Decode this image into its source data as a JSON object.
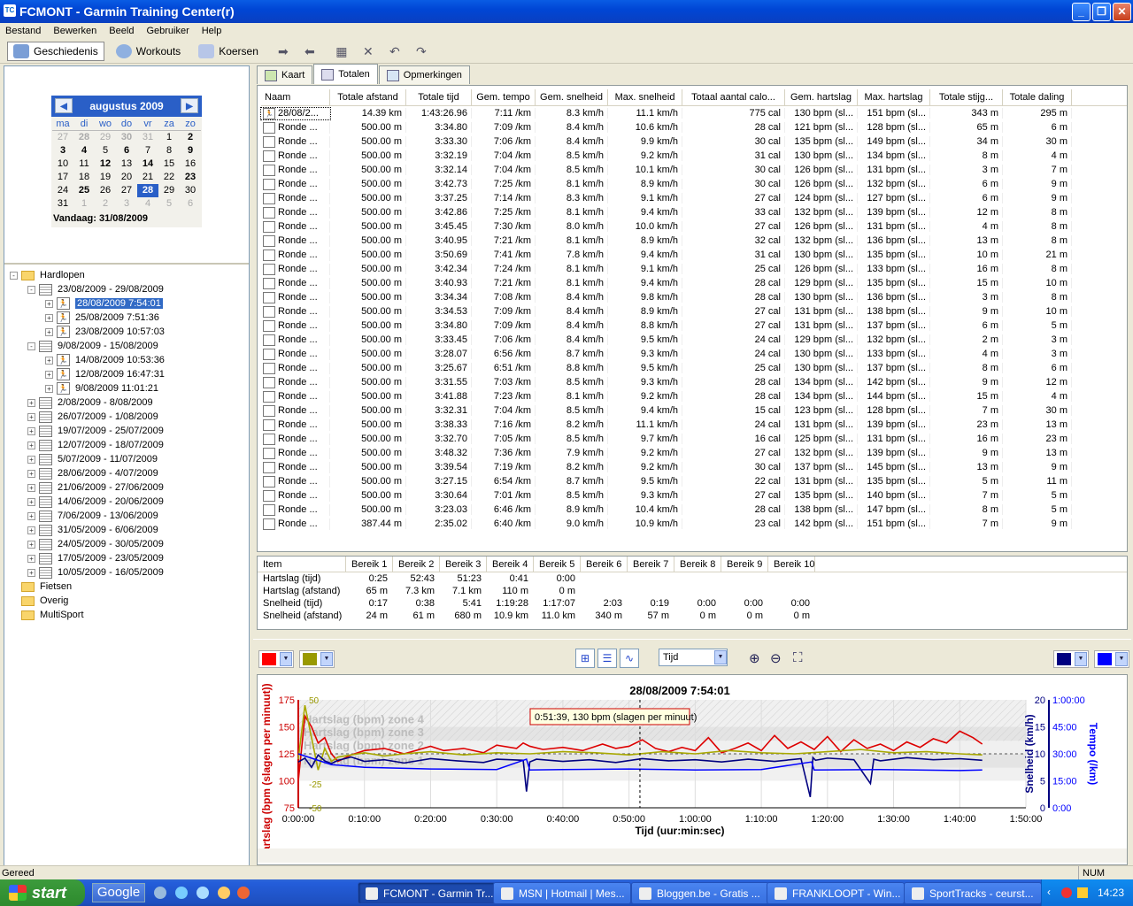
{
  "window": {
    "title": "FCMONT - Garmin Training Center(r)"
  },
  "menu": [
    "Bestand",
    "Bewerken",
    "Beeld",
    "Gebruiker",
    "Help"
  ],
  "toolbar": {
    "history": "Geschiedenis",
    "workouts": "Workouts",
    "courses": "Koersen"
  },
  "calendar": {
    "month": "augustus 2009",
    "days": [
      "ma",
      "di",
      "wo",
      "do",
      "vr",
      "za",
      "zo"
    ],
    "cells": [
      [
        "27",
        "o"
      ],
      [
        "28",
        "ob"
      ],
      [
        "29",
        "o"
      ],
      [
        "30",
        "ob"
      ],
      [
        "31",
        "o"
      ],
      [
        "1",
        ""
      ],
      [
        "2",
        "b"
      ],
      [
        "3",
        "b"
      ],
      [
        "4",
        "b"
      ],
      [
        "5",
        ""
      ],
      [
        "6",
        "b"
      ],
      [
        "7",
        ""
      ],
      [
        "8",
        ""
      ],
      [
        "9",
        "b"
      ],
      [
        "10",
        ""
      ],
      [
        "11",
        ""
      ],
      [
        "12",
        "b"
      ],
      [
        "13",
        ""
      ],
      [
        "14",
        "b"
      ],
      [
        "15",
        ""
      ],
      [
        "16",
        ""
      ],
      [
        "17",
        ""
      ],
      [
        "18",
        ""
      ],
      [
        "19",
        ""
      ],
      [
        "20",
        ""
      ],
      [
        "21",
        ""
      ],
      [
        "22",
        ""
      ],
      [
        "23",
        "b"
      ],
      [
        "24",
        ""
      ],
      [
        "25",
        "b"
      ],
      [
        "26",
        ""
      ],
      [
        "27",
        ""
      ],
      [
        "28",
        "s"
      ],
      [
        "29",
        ""
      ],
      [
        "30",
        ""
      ],
      [
        "31",
        ""
      ],
      [
        "1",
        "o"
      ],
      [
        "2",
        "o"
      ],
      [
        "3",
        "o"
      ],
      [
        "4",
        "o"
      ],
      [
        "5",
        "o"
      ],
      [
        "6",
        "o"
      ]
    ],
    "today": "Vandaag: 31/08/2009"
  },
  "tree": [
    {
      "level": 0,
      "type": "folder",
      "label": "Hardlopen",
      "exp": "-"
    },
    {
      "level": 1,
      "type": "cal",
      "label": "23/08/2009 - 29/08/2009",
      "exp": "-"
    },
    {
      "level": 2,
      "type": "run",
      "label": "28/08/2009 7:54:01",
      "exp": "+",
      "sel": true
    },
    {
      "level": 2,
      "type": "run",
      "label": "25/08/2009 7:51:36",
      "exp": "+"
    },
    {
      "level": 2,
      "type": "run",
      "label": "23/08/2009 10:57:03",
      "exp": "+"
    },
    {
      "level": 1,
      "type": "cal",
      "label": "9/08/2009 - 15/08/2009",
      "exp": "-"
    },
    {
      "level": 2,
      "type": "run",
      "label": "14/08/2009 10:53:36",
      "exp": "+"
    },
    {
      "level": 2,
      "type": "run",
      "label": "12/08/2009 16:47:31",
      "exp": "+"
    },
    {
      "level": 2,
      "type": "run",
      "label": "9/08/2009 11:01:21",
      "exp": "+"
    },
    {
      "level": 1,
      "type": "cal",
      "label": "2/08/2009 - 8/08/2009",
      "exp": "+"
    },
    {
      "level": 1,
      "type": "cal",
      "label": "26/07/2009 - 1/08/2009",
      "exp": "+"
    },
    {
      "level": 1,
      "type": "cal",
      "label": "19/07/2009 - 25/07/2009",
      "exp": "+"
    },
    {
      "level": 1,
      "type": "cal",
      "label": "12/07/2009 - 18/07/2009",
      "exp": "+"
    },
    {
      "level": 1,
      "type": "cal",
      "label": "5/07/2009 - 11/07/2009",
      "exp": "+"
    },
    {
      "level": 1,
      "type": "cal",
      "label": "28/06/2009 - 4/07/2009",
      "exp": "+"
    },
    {
      "level": 1,
      "type": "cal",
      "label": "21/06/2009 - 27/06/2009",
      "exp": "+"
    },
    {
      "level": 1,
      "type": "cal",
      "label": "14/06/2009 - 20/06/2009",
      "exp": "+"
    },
    {
      "level": 1,
      "type": "cal",
      "label": "7/06/2009 - 13/06/2009",
      "exp": "+"
    },
    {
      "level": 1,
      "type": "cal",
      "label": "31/05/2009 - 6/06/2009",
      "exp": "+"
    },
    {
      "level": 1,
      "type": "cal",
      "label": "24/05/2009 - 30/05/2009",
      "exp": "+"
    },
    {
      "level": 1,
      "type": "cal",
      "label": "17/05/2009 - 23/05/2009",
      "exp": "+"
    },
    {
      "level": 1,
      "type": "cal",
      "label": "10/05/2009 - 16/05/2009",
      "exp": "+"
    },
    {
      "level": 0,
      "type": "folder",
      "label": "Fietsen",
      "exp": ""
    },
    {
      "level": 0,
      "type": "folder",
      "label": "Overig",
      "exp": ""
    },
    {
      "level": 0,
      "type": "folder",
      "label": "MultiSport",
      "exp": ""
    }
  ],
  "tabs": [
    "Kaart",
    "Totalen",
    "Opmerkingen"
  ],
  "laps": {
    "columns": [
      "Naam",
      "Totale afstand",
      "Totale tijd",
      "Gem. tempo",
      "Gem. snelheid",
      "Max. snelheid",
      "Totaal aantal calo...",
      "Gem. hartslag",
      "Max. hartslag",
      "Totale stijg...",
      "Totale daling"
    ],
    "rows": [
      [
        "28/08/2...",
        "14.39 km",
        "1:43:26.96",
        "7:11 /km",
        "8.3 km/h",
        "11.1 km/h",
        "775 cal",
        "130 bpm (sl...",
        "151 bpm (sl...",
        "343 m",
        "295 m"
      ],
      [
        "Ronde ...",
        "500.00 m",
        "3:34.80",
        "7:09 /km",
        "8.4 km/h",
        "10.6 km/h",
        "28 cal",
        "121 bpm (sl...",
        "128 bpm (sl...",
        "65 m",
        "6 m"
      ],
      [
        "Ronde ...",
        "500.00 m",
        "3:33.30",
        "7:06 /km",
        "8.4 km/h",
        "9.9 km/h",
        "30 cal",
        "135 bpm (sl...",
        "149 bpm (sl...",
        "34 m",
        "30 m"
      ],
      [
        "Ronde ...",
        "500.00 m",
        "3:32.19",
        "7:04 /km",
        "8.5 km/h",
        "9.2 km/h",
        "31 cal",
        "130 bpm (sl...",
        "134 bpm (sl...",
        "8 m",
        "4 m"
      ],
      [
        "Ronde ...",
        "500.00 m",
        "3:32.14",
        "7:04 /km",
        "8.5 km/h",
        "10.1 km/h",
        "30 cal",
        "126 bpm (sl...",
        "131 bpm (sl...",
        "3 m",
        "7 m"
      ],
      [
        "Ronde ...",
        "500.00 m",
        "3:42.73",
        "7:25 /km",
        "8.1 km/h",
        "8.9 km/h",
        "30 cal",
        "126 bpm (sl...",
        "132 bpm (sl...",
        "6 m",
        "9 m"
      ],
      [
        "Ronde ...",
        "500.00 m",
        "3:37.25",
        "7:14 /km",
        "8.3 km/h",
        "9.1 km/h",
        "27 cal",
        "124 bpm (sl...",
        "127 bpm (sl...",
        "6 m",
        "9 m"
      ],
      [
        "Ronde ...",
        "500.00 m",
        "3:42.86",
        "7:25 /km",
        "8.1 km/h",
        "9.4 km/h",
        "33 cal",
        "132 bpm (sl...",
        "139 bpm (sl...",
        "12 m",
        "8 m"
      ],
      [
        "Ronde ...",
        "500.00 m",
        "3:45.45",
        "7:30 /km",
        "8.0 km/h",
        "10.0 km/h",
        "27 cal",
        "126 bpm (sl...",
        "131 bpm (sl...",
        "4 m",
        "8 m"
      ],
      [
        "Ronde ...",
        "500.00 m",
        "3:40.95",
        "7:21 /km",
        "8.1 km/h",
        "8.9 km/h",
        "32 cal",
        "132 bpm (sl...",
        "136 bpm (sl...",
        "13 m",
        "8 m"
      ],
      [
        "Ronde ...",
        "500.00 m",
        "3:50.69",
        "7:41 /km",
        "7.8 km/h",
        "9.4 km/h",
        "31 cal",
        "130 bpm (sl...",
        "135 bpm (sl...",
        "10 m",
        "21 m"
      ],
      [
        "Ronde ...",
        "500.00 m",
        "3:42.34",
        "7:24 /km",
        "8.1 km/h",
        "9.1 km/h",
        "25 cal",
        "126 bpm (sl...",
        "133 bpm (sl...",
        "16 m",
        "8 m"
      ],
      [
        "Ronde ...",
        "500.00 m",
        "3:40.93",
        "7:21 /km",
        "8.1 km/h",
        "9.4 km/h",
        "28 cal",
        "129 bpm (sl...",
        "135 bpm (sl...",
        "15 m",
        "10 m"
      ],
      [
        "Ronde ...",
        "500.00 m",
        "3:34.34",
        "7:08 /km",
        "8.4 km/h",
        "9.8 km/h",
        "28 cal",
        "130 bpm (sl...",
        "136 bpm (sl...",
        "3 m",
        "8 m"
      ],
      [
        "Ronde ...",
        "500.00 m",
        "3:34.53",
        "7:09 /km",
        "8.4 km/h",
        "8.9 km/h",
        "27 cal",
        "131 bpm (sl...",
        "138 bpm (sl...",
        "9 m",
        "10 m"
      ],
      [
        "Ronde ...",
        "500.00 m",
        "3:34.80",
        "7:09 /km",
        "8.4 km/h",
        "8.8 km/h",
        "27 cal",
        "131 bpm (sl...",
        "137 bpm (sl...",
        "6 m",
        "5 m"
      ],
      [
        "Ronde ...",
        "500.00 m",
        "3:33.45",
        "7:06 /km",
        "8.4 km/h",
        "9.5 km/h",
        "24 cal",
        "129 bpm (sl...",
        "132 bpm (sl...",
        "2 m",
        "3 m"
      ],
      [
        "Ronde ...",
        "500.00 m",
        "3:28.07",
        "6:56 /km",
        "8.7 km/h",
        "9.3 km/h",
        "24 cal",
        "130 bpm (sl...",
        "133 bpm (sl...",
        "4 m",
        "3 m"
      ],
      [
        "Ronde ...",
        "500.00 m",
        "3:25.67",
        "6:51 /km",
        "8.8 km/h",
        "9.5 km/h",
        "25 cal",
        "130 bpm (sl...",
        "137 bpm (sl...",
        "8 m",
        "6 m"
      ],
      [
        "Ronde ...",
        "500.00 m",
        "3:31.55",
        "7:03 /km",
        "8.5 km/h",
        "9.3 km/h",
        "28 cal",
        "134 bpm (sl...",
        "142 bpm (sl...",
        "9 m",
        "12 m"
      ],
      [
        "Ronde ...",
        "500.00 m",
        "3:41.88",
        "7:23 /km",
        "8.1 km/h",
        "9.2 km/h",
        "28 cal",
        "134 bpm (sl...",
        "144 bpm (sl...",
        "15 m",
        "4 m"
      ],
      [
        "Ronde ...",
        "500.00 m",
        "3:32.31",
        "7:04 /km",
        "8.5 km/h",
        "9.4 km/h",
        "15 cal",
        "123 bpm (sl...",
        "128 bpm (sl...",
        "7 m",
        "30 m"
      ],
      [
        "Ronde ...",
        "500.00 m",
        "3:38.33",
        "7:16 /km",
        "8.2 km/h",
        "11.1 km/h",
        "24 cal",
        "131 bpm (sl...",
        "139 bpm (sl...",
        "23 m",
        "13 m"
      ],
      [
        "Ronde ...",
        "500.00 m",
        "3:32.70",
        "7:05 /km",
        "8.5 km/h",
        "9.7 km/h",
        "16 cal",
        "125 bpm (sl...",
        "131 bpm (sl...",
        "16 m",
        "23 m"
      ],
      [
        "Ronde ...",
        "500.00 m",
        "3:48.32",
        "7:36 /km",
        "7.9 km/h",
        "9.2 km/h",
        "27 cal",
        "132 bpm (sl...",
        "139 bpm (sl...",
        "9 m",
        "13 m"
      ],
      [
        "Ronde ...",
        "500.00 m",
        "3:39.54",
        "7:19 /km",
        "8.2 km/h",
        "9.2 km/h",
        "30 cal",
        "137 bpm (sl...",
        "145 bpm (sl...",
        "13 m",
        "9 m"
      ],
      [
        "Ronde ...",
        "500.00 m",
        "3:27.15",
        "6:54 /km",
        "8.7 km/h",
        "9.5 km/h",
        "22 cal",
        "131 bpm (sl...",
        "135 bpm (sl...",
        "5 m",
        "11 m"
      ],
      [
        "Ronde ...",
        "500.00 m",
        "3:30.64",
        "7:01 /km",
        "8.5 km/h",
        "9.3 km/h",
        "27 cal",
        "135 bpm (sl...",
        "140 bpm (sl...",
        "7 m",
        "5 m"
      ],
      [
        "Ronde ...",
        "500.00 m",
        "3:23.03",
        "6:46 /km",
        "8.9 km/h",
        "10.4 km/h",
        "28 cal",
        "138 bpm (sl...",
        "147 bpm (sl...",
        "8 m",
        "5 m"
      ],
      [
        "Ronde ...",
        "387.44 m",
        "2:35.02",
        "6:40 /km",
        "9.0 km/h",
        "10.9 km/h",
        "23 cal",
        "142 bpm (sl...",
        "151 bpm (sl...",
        "7 m",
        "9 m"
      ]
    ]
  },
  "zones": {
    "columns": [
      "Item",
      "Bereik 1",
      "Bereik 2",
      "Bereik 3",
      "Bereik 4",
      "Bereik 5",
      "Bereik 6",
      "Bereik 7",
      "Bereik 8",
      "Bereik 9",
      "Bereik 10"
    ],
    "rows": [
      [
        "Hartslag (tijd)",
        "0:25",
        "52:43",
        "51:23",
        "0:41",
        "0:00",
        "",
        "",
        "",
        "",
        ""
      ],
      [
        "Hartslag (afstand)",
        "65 m",
        "7.3 km",
        "7.1 km",
        "110 m",
        "0 m",
        "",
        "",
        "",
        "",
        ""
      ],
      [
        "Snelheid (tijd)",
        "0:17",
        "0:38",
        "5:41",
        "1:19:28",
        "1:17:07",
        "2:03",
        "0:19",
        "0:00",
        "0:00",
        "0:00"
      ],
      [
        "Snelheid (afstand)",
        "24 m",
        "61 m",
        "680 m",
        "10.9 km",
        "11.0 km",
        "340 m",
        "57 m",
        "0 m",
        "0 m",
        "0 m"
      ]
    ]
  },
  "graph": {
    "axis_select": "Tijd",
    "colors": {
      "hr": "#ff0000",
      "elev": "#999900",
      "speed": "#000080",
      "pace": "#0000ff"
    }
  },
  "chart_data": {
    "type": "line",
    "title": "28/08/2009 7:54:01",
    "xlabel": "Tijd (uur:min:sec)",
    "ylabel_left": "Hartslag (bpm (slagen per minuut))",
    "ylabel_right": [
      "Snelheid (km/h)",
      "Tempo (/km)"
    ],
    "x_ticks": [
      "0:00:00",
      "0:10:00",
      "0:20:00",
      "0:30:00",
      "0:40:00",
      "0:50:00",
      "1:00:00",
      "1:10:00",
      "1:20:00",
      "1:30:00",
      "1:40:00",
      "1:50:00"
    ],
    "xlim_min": [
      0,
      110
    ],
    "y_left_ticks": [
      "75",
      "100",
      "125",
      "150",
      "175"
    ],
    "ylim_left": [
      75,
      175
    ],
    "y_right_speed_ticks": [
      "0",
      "5",
      "10",
      "15",
      "20"
    ],
    "y_right_pace_ticks": [
      "0:00",
      "15:00",
      "30:00",
      "45:00",
      "1:00:00"
    ],
    "zones": [
      "Hartslag (bpm) zone 4",
      "Hartslag (bpm) zone 3",
      "Hartslag (bpm) zone 2",
      "Hartslag (bpm) zone 1"
    ],
    "elev_ticks": [
      "-25",
      "-50",
      "50"
    ],
    "tooltip": "0:51:39, 130 bpm (slagen per minuut)",
    "series": [
      {
        "name": "Hartslag",
        "color": "#dd0000",
        "x": [
          0,
          1,
          2,
          3,
          4,
          5,
          6,
          8,
          10,
          13,
          16,
          20,
          22,
          25,
          28,
          30,
          33,
          34,
          35,
          37,
          40,
          43,
          46,
          48,
          50,
          52,
          54,
          56,
          58,
          60,
          62,
          64,
          66,
          68,
          70,
          72,
          74,
          76,
          78,
          80,
          82,
          84,
          86,
          88,
          90,
          92,
          94,
          96,
          98,
          100,
          102,
          103.4
        ],
        "y": [
          100,
          160,
          150,
          135,
          140,
          125,
          118,
          124,
          128,
          130,
          125,
          132,
          128,
          130,
          126,
          133,
          130,
          135,
          132,
          129,
          131,
          128,
          134,
          130,
          132,
          138,
          130,
          127,
          131,
          128,
          140,
          126,
          130,
          135,
          128,
          142,
          130,
          136,
          129,
          141,
          127,
          138,
          130,
          134,
          128,
          136,
          131,
          139,
          135,
          146,
          140,
          134
        ]
      },
      {
        "name": "Hoogte",
        "color": "#a8a800",
        "x": [
          0,
          1,
          2,
          3,
          4,
          5,
          6,
          8,
          10,
          13,
          16,
          20,
          25,
          30,
          35,
          40,
          45,
          50,
          55,
          60,
          65,
          70,
          75,
          80,
          85,
          90,
          95,
          100,
          103.4
        ],
        "y": [
          120,
          170,
          140,
          110,
          130,
          118,
          122,
          124,
          126,
          123,
          125,
          127,
          124,
          126,
          125,
          127,
          126,
          124,
          127,
          125,
          128,
          126,
          125,
          127,
          129,
          126,
          127,
          125,
          124
        ]
      },
      {
        "name": "Snelheid",
        "color": "#000080",
        "x": [
          0,
          1,
          2,
          3,
          4,
          5,
          6,
          8,
          10,
          13,
          16,
          20,
          24,
          28,
          30,
          34,
          34.5,
          35,
          36,
          40,
          44,
          48,
          52,
          56,
          60,
          64,
          68,
          72,
          76,
          77.4,
          77.8,
          78.2,
          80,
          84,
          86.5,
          87,
          88,
          92,
          96,
          100,
          103.4
        ],
        "y": [
          8.5,
          9.2,
          7.5,
          9.8,
          8.7,
          8.2,
          8.8,
          9.4,
          8.6,
          8.9,
          8.3,
          9.1,
          8.7,
          8.4,
          9.0,
          8.8,
          3,
          8.5,
          9.0,
          8.6,
          8.9,
          8.4,
          9.1,
          8.7,
          8.9,
          8.5,
          9.0,
          8.6,
          9.1,
          2,
          9.3,
          8.8,
          9.2,
          8.9,
          4.5,
          9.0,
          8.7,
          9.3,
          8.9,
          9.1,
          8.8
        ]
      },
      {
        "name": "Tempo",
        "color": "#0000ff",
        "x": [
          0,
          5,
          10,
          20,
          30,
          34.5,
          35,
          40,
          50,
          60,
          70,
          77.6,
          78,
          88,
          100,
          103.4
        ],
        "y": [
          10,
          8,
          7.5,
          7.2,
          7.1,
          9,
          7.0,
          7.1,
          7.2,
          7.0,
          7.1,
          8.5,
          7.0,
          7.1,
          6.9,
          7.0
        ]
      }
    ]
  },
  "status": {
    "left": "Gereed",
    "right": "NUM"
  },
  "taskbar": {
    "start": "start",
    "google": "Google",
    "tasks": [
      "FCMONT - Garmin Tr...",
      "MSN | Hotmail | Mes...",
      "Bloggen.be - Gratis ...",
      "FRANKLOOPT - Win...",
      "SportTracks - ceurst..."
    ],
    "clock": "14:23"
  }
}
